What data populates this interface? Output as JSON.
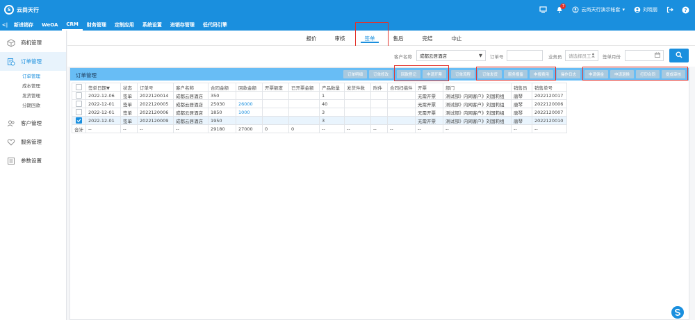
{
  "app": {
    "logo_mark": "S",
    "logo_text": "云尚天行",
    "company": "云尚天行演示帐套",
    "user": "刘晓丽",
    "notification_count": "7"
  },
  "modules": [
    "新进销存",
    "WeOA",
    "CRM",
    "财务管理",
    "定制应用",
    "系统设置",
    "进销存管理",
    "低代码引擎"
  ],
  "sidebar": {
    "items": [
      {
        "label": "商机管理"
      },
      {
        "label": "订单管理"
      },
      {
        "label": "客户管理"
      },
      {
        "label": "服务管理"
      },
      {
        "label": "参数设置"
      }
    ],
    "subitems": [
      "订单管理",
      "成本管理",
      "发货管理",
      "分期回款"
    ]
  },
  "stages": [
    "报价",
    "审核",
    "签单",
    "售后",
    "完结",
    "中止"
  ],
  "filter": {
    "customer_label": "客户名称",
    "customer_value": "成都云居酒店",
    "order_no_label": "订单号",
    "salesman_label": "业务员",
    "salesman_placeholder": "请选择员工",
    "month_label": "签单月份"
  },
  "panel": {
    "title": "订单管理",
    "actions": [
      "订单明细",
      "订单修改",
      "回款登记",
      "申请开票",
      "订单流程",
      "订单发货",
      "服务报备",
      "申报费用",
      "操作日志",
      "申请佣金",
      "申请退换",
      "打印合同",
      "提成审核"
    ]
  },
  "table": {
    "headers": [
      "",
      "签单日期",
      "状态",
      "订单号",
      "客户名称",
      "合同金额",
      "回款金额",
      "开票额度",
      "已开票金额",
      "产品数量",
      "发货件数",
      "附件",
      "合同扫描件",
      "开票",
      "部门",
      "销售员",
      "销售单号"
    ],
    "sort_arrow": "▼",
    "rows": [
      {
        "checked": false,
        "cells": [
          "2022-12-06",
          "签单",
          "2022120014",
          "成都云居酒店",
          "350",
          "",
          "",
          "",
          "1",
          "",
          "",
          "",
          "无需开票",
          "测试部》内网客户》刘国莉组",
          "唐琴",
          "2022120017"
        ]
      },
      {
        "checked": false,
        "cells": [
          "2022-12-01",
          "签单",
          "2022120005",
          "成都云居酒店",
          "25030",
          "26000",
          "",
          "",
          "40",
          "",
          "",
          "",
          "无需开票",
          "测试部》内网客户》刘国莉组",
          "唐琴",
          "2022120006"
        ]
      },
      {
        "checked": false,
        "cells": [
          "2022-12-01",
          "签单",
          "2022120006",
          "成都云居酒店",
          "1850",
          "1000",
          "",
          "",
          "3",
          "",
          "",
          "",
          "无需开票",
          "测试部》内网客户》刘国莉组",
          "唐琴",
          "2022120007"
        ]
      },
      {
        "checked": true,
        "cells": [
          "2022-12-01",
          "签单",
          "2022120009",
          "成都云居酒店",
          "1950",
          "",
          "",
          "",
          "3",
          "",
          "",
          "",
          "无需开票",
          "测试部》内网客户》刘国莉组",
          "唐琴",
          "2022120010"
        ]
      }
    ],
    "total": [
      "合计",
      "--",
      "--",
      "--",
      "--",
      "29180",
      "27000",
      "0",
      "0",
      "--",
      "--",
      "--",
      "--",
      "--",
      "--",
      "--",
      "--"
    ]
  },
  "colors": {
    "primary": "#1a8fde",
    "highlight": "#e3322b",
    "title_bar": "#68bdf5",
    "button_muted": "#a8c9df"
  }
}
